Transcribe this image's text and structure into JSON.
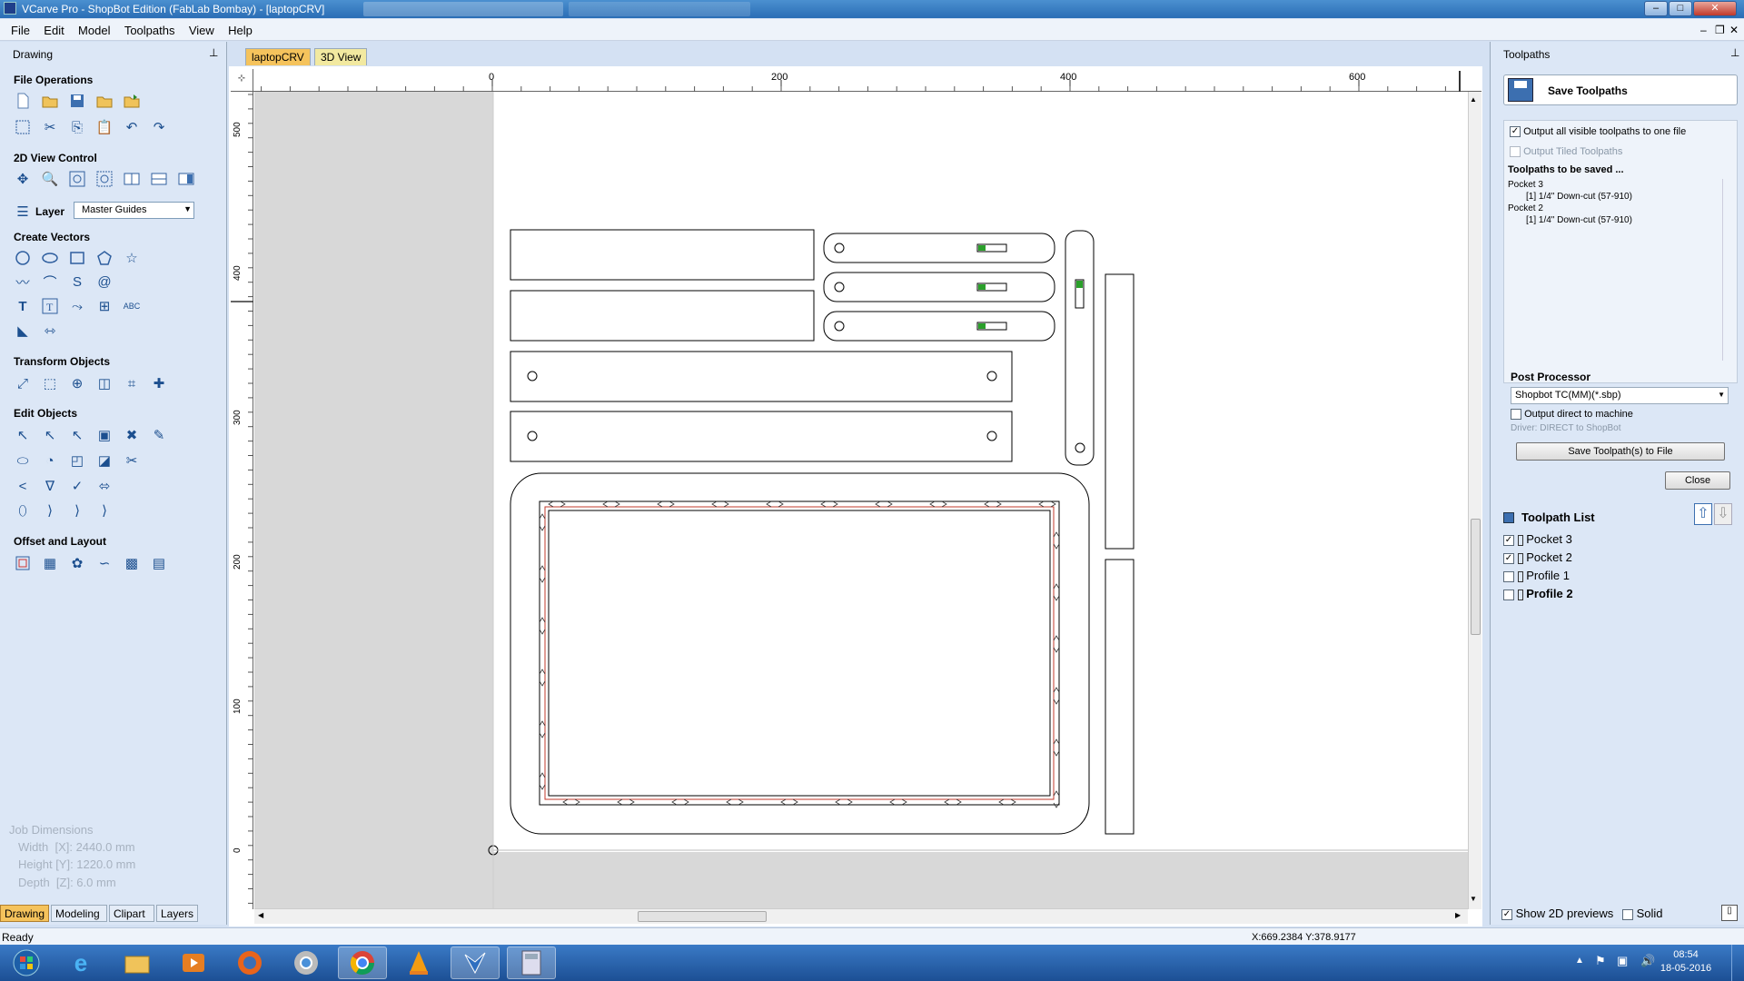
{
  "window": {
    "title": "VCarve Pro - ShopBot Edition (FabLab Bombay) - [laptopCRV]",
    "min": "–",
    "max": "□",
    "close": "✕"
  },
  "menu": [
    "File",
    "Edit",
    "Model",
    "Toolpaths",
    "View",
    "Help"
  ],
  "left_panel": {
    "title": "Drawing",
    "pin": "⊥",
    "sections": {
      "file_ops": "File Operations",
      "view_control": "2D View Control",
      "layer_label": "Layer",
      "layer_value": "Master Guides",
      "create_vectors": "Create Vectors",
      "transform": "Transform Objects",
      "edit_objects": "Edit Objects",
      "offset_layout": "Offset and Layout"
    },
    "job_dimensions": {
      "title": "Job Dimensions",
      "width": "Width  [X]: 2440.0 mm",
      "height": "Height [Y]: 1220.0 mm",
      "depth": "Depth  [Z]: 6.0 mm"
    },
    "bottom_tabs": [
      "Drawing",
      "Modeling",
      "Clipart",
      "Layers"
    ]
  },
  "doc_tabs": [
    "laptopCRV",
    "3D View"
  ],
  "ruler": {
    "top_labels": [
      "0",
      "200",
      "400",
      "600"
    ],
    "left_labels": [
      "500",
      "400",
      "300",
      "200",
      "100",
      "0"
    ]
  },
  "right_panel": {
    "title": "Toolpaths",
    "save_header": "Save Toolpaths",
    "output_all": "Output all visible toolpaths to one file",
    "output_tiled": "Output Tiled Toolpaths",
    "to_be_saved_title": "Toolpaths to be saved ...",
    "to_be_saved": [
      "Pocket 3",
      "[1] 1/4\"  Down-cut (57-910)",
      "Pocket 2",
      "[1] 1/4\"  Down-cut (57-910)"
    ],
    "post_processor_label": "Post Processor",
    "post_processor_value": "Shopbot TC(MM)(*.sbp)",
    "output_direct": "Output direct to machine",
    "driver": "Driver: DIRECT to ShopBot",
    "save_button": "Save Toolpath(s) to File",
    "close_button": "Close",
    "list_title": "Toolpath List",
    "list": [
      {
        "name": "Pocket 3",
        "checked": true
      },
      {
        "name": "Pocket 2",
        "checked": true
      },
      {
        "name": "Profile 1",
        "checked": false
      },
      {
        "name": "Profile 2",
        "checked": false
      }
    ],
    "show_2d": "Show 2D previews",
    "solid": "Solid"
  },
  "status": {
    "left": "Ready",
    "coords": "X:669.2384 Y:378.9177"
  },
  "tray": {
    "time": "08:54",
    "date": "18-05-2016"
  }
}
